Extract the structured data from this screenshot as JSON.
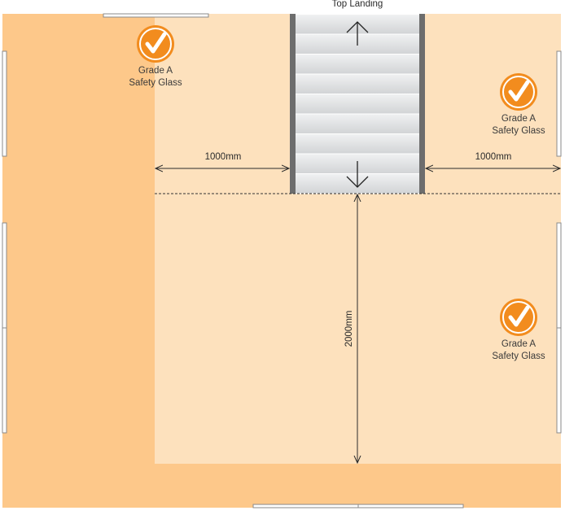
{
  "diagram": {
    "landing_label": "Top Landing",
    "dimension_left": "1000mm",
    "dimension_right": "1000mm",
    "dimension_vertical": "2000mm",
    "badges": [
      {
        "line1": "Grade A",
        "line2": "Safety Glass"
      },
      {
        "line1": "Grade A",
        "line2": "Safety Glass"
      },
      {
        "line1": "Grade A",
        "line2": "Safety Glass"
      }
    ],
    "colors": {
      "outer_zone": "#fdc88a",
      "safety_zone": "#fde1bd",
      "badge": "#f28c1e",
      "stair_frame": "#6d6d6d",
      "stair_tread": "#e3e4e6",
      "dimension_line": "#2b2b2b"
    },
    "icons": [
      "check-icon",
      "up-arrow-icon",
      "down-arrow-icon"
    ]
  }
}
